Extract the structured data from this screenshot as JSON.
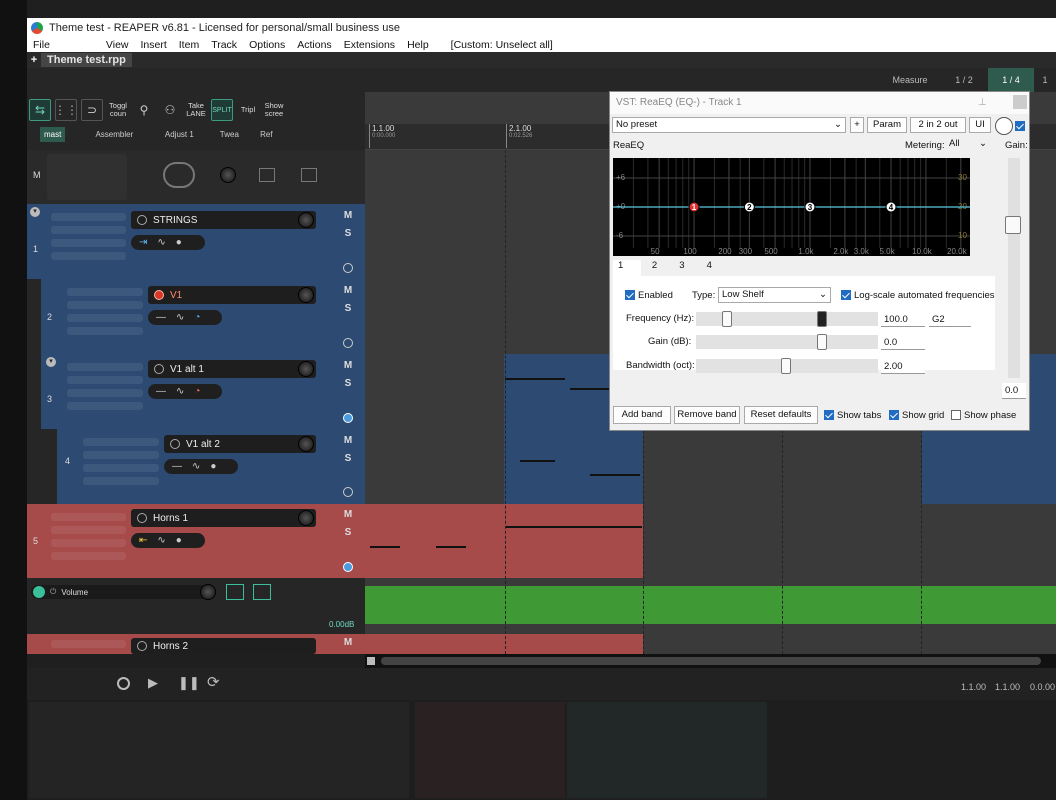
{
  "window": {
    "title": "Theme test - REAPER v6.81 - Licensed for personal/small business use"
  },
  "menu": [
    "File",
    "View",
    "Insert",
    "Item",
    "Track",
    "Options",
    "Actions",
    "Extensions",
    "Help",
    "[Custom: Unselect all]"
  ],
  "project_tab": "Theme test.rpp",
  "ruler": {
    "measure_label": "Measure",
    "half": "1 / 2",
    "quarter": "1 / 4",
    "one": "1"
  },
  "toolbar": {
    "toggle_count": "Toggl\ncoun",
    "take_lane": "Take\nLANE",
    "split": "SPLIT",
    "tripl": "Tripl",
    "show_screen": "Show\nscree"
  },
  "modes": [
    "mast",
    "Assembler",
    "Adjust 1",
    "Twea",
    "Ref"
  ],
  "timeline": [
    {
      "label": "1.1.00",
      "sub": "0:00.000"
    },
    {
      "label": "2.1.00",
      "sub": "0:02.526"
    }
  ],
  "master": {
    "label": "M"
  },
  "tracks": [
    {
      "num": "1",
      "name": "STRINGS",
      "color": "blue"
    },
    {
      "num": "2",
      "name": "V1",
      "color": "blue"
    },
    {
      "num": "3",
      "name": "V1 alt 1",
      "color": "blue"
    },
    {
      "num": "4",
      "name": "V1 alt 2",
      "color": "blue"
    },
    {
      "num": "5",
      "name": "Horns 1",
      "color": "red"
    },
    {
      "num": "",
      "name": "Horns 2",
      "color": "red"
    }
  ],
  "ms": {
    "m": "M",
    "s": "S"
  },
  "envelope": {
    "name": "Volume",
    "value": "0.00dB"
  },
  "transport": {
    "pos1": "1.1.00",
    "pos2": "1.1.00",
    "pos3": "0.0.00"
  },
  "fx": {
    "title": "VST: ReaEQ (EQ-) - Track 1",
    "preset": "No preset",
    "plus": "+",
    "param": "Param",
    "io": "2 in 2 out",
    "ui": "UI",
    "plugin_name": "ReaEQ",
    "metering_label": "Metering:",
    "metering_value": "All",
    "gain_label": "Gain:",
    "db_labels": [
      "+6",
      "+0",
      "-6"
    ],
    "right_db": [
      "30",
      "20",
      "10"
    ],
    "freq_labels": [
      "50",
      "100",
      "200",
      "300",
      "500",
      "1.0k",
      "2.0k",
      "3.0k",
      "5.0k",
      "10.0k",
      "20.0k"
    ],
    "band_nodes": [
      "1",
      "2",
      "3",
      "4"
    ],
    "tabs": [
      "1",
      "2",
      "3",
      "4"
    ],
    "enabled": "Enabled",
    "type_label": "Type:",
    "type_value": "Low Shelf",
    "log_scale": "Log-scale automated frequencies",
    "freq_label": "Frequency (Hz):",
    "freq_value": "100.0",
    "note_value": "G2",
    "gain_db_label": "Gain (dB):",
    "gain_value": "0.0",
    "bw_label": "Bandwidth (oct):",
    "bw_value": "2.00",
    "gain_readout": "0.0",
    "add_band": "Add band",
    "remove_band": "Remove band",
    "reset": "Reset defaults",
    "show_tabs": "Show tabs",
    "show_grid": "Show grid",
    "show_phase": "Show phase"
  }
}
